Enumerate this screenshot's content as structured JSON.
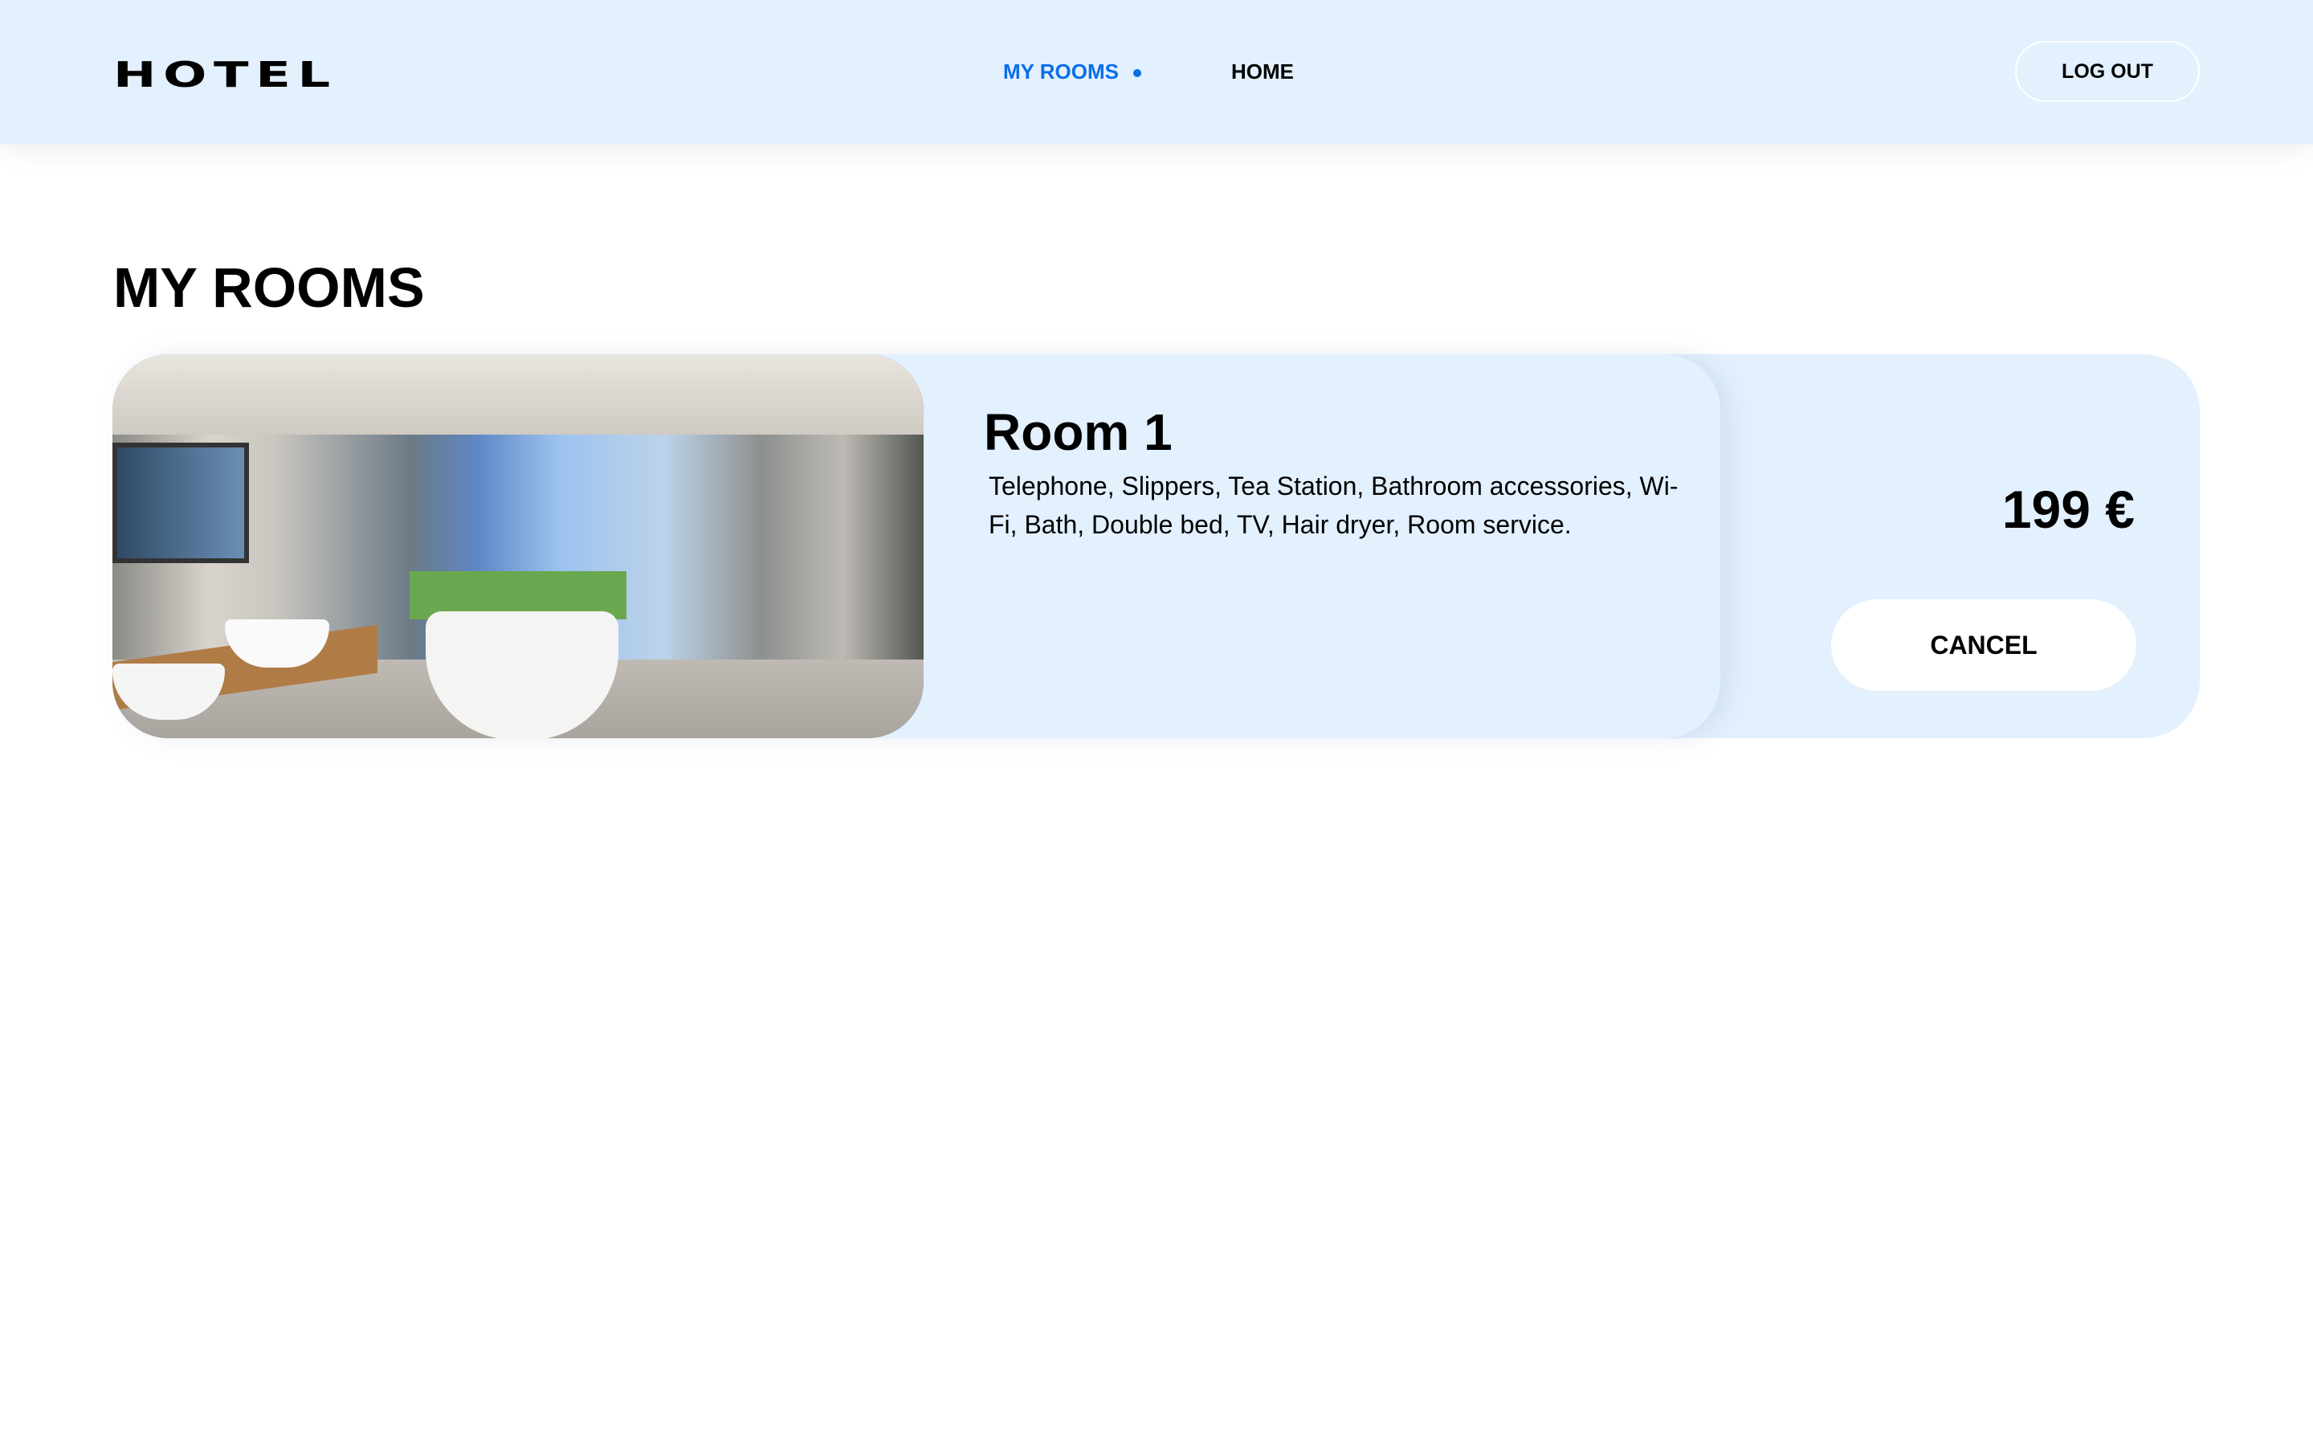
{
  "header": {
    "logo": "HOTEL",
    "nav": [
      {
        "label": "MY ROOMS",
        "active": true
      },
      {
        "label": "HOME",
        "active": false
      }
    ],
    "logout_label": "LOG OUT"
  },
  "page": {
    "title": "MY ROOMS"
  },
  "rooms": [
    {
      "name": "Room 1",
      "amenities": "Telephone, Slippers, Tea Station, Bathroom accessories, Wi-Fi, Bath, Double bed, TV, Hair dryer, Room service.",
      "price": "199 €",
      "cancel_label": "CANCEL"
    }
  ],
  "colors": {
    "accent": "#0a6fe8",
    "header_bg": "#e3f0fe",
    "card_bg": "#e3f0fe"
  }
}
